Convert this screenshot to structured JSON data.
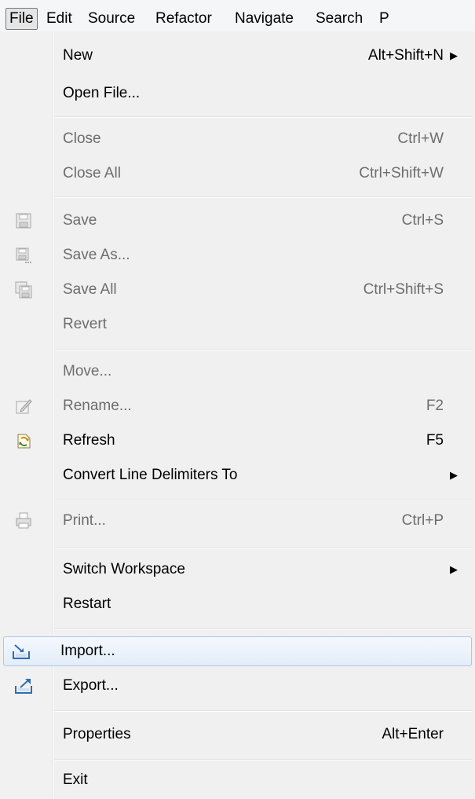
{
  "menubar": {
    "file": "File",
    "edit": "Edit",
    "source": "Source",
    "refactor": "Refactor",
    "navigate": "Navigate",
    "search": "Search",
    "project": "P"
  },
  "menu": {
    "new": {
      "label": "New",
      "accel": "Alt+Shift+N"
    },
    "open_file": {
      "label": "Open File..."
    },
    "close": {
      "label": "Close",
      "accel": "Ctrl+W"
    },
    "close_all": {
      "label": "Close All",
      "accel": "Ctrl+Shift+W"
    },
    "save": {
      "label": "Save",
      "accel": "Ctrl+S"
    },
    "save_as": {
      "label": "Save As..."
    },
    "save_all": {
      "label": "Save All",
      "accel": "Ctrl+Shift+S"
    },
    "revert": {
      "label": "Revert"
    },
    "move": {
      "label": "Move..."
    },
    "rename": {
      "label": "Rename...",
      "accel": "F2"
    },
    "refresh": {
      "label": "Refresh",
      "accel": "F5"
    },
    "convert": {
      "label": "Convert Line Delimiters To"
    },
    "print": {
      "label": "Print...",
      "accel": "Ctrl+P"
    },
    "switch_workspace": {
      "label": "Switch Workspace"
    },
    "restart": {
      "label": "Restart"
    },
    "import": {
      "label": "Import..."
    },
    "export": {
      "label": "Export..."
    },
    "properties": {
      "label": "Properties",
      "accel": "Alt+Enter"
    },
    "exit": {
      "label": "Exit"
    }
  },
  "icons": {
    "save": "save-icon",
    "save_as": "save-as-icon",
    "save_all": "save-all-icon",
    "rename": "rename-icon",
    "refresh": "refresh-icon",
    "print": "print-icon",
    "import": "import-icon",
    "export": "export-icon",
    "submenu": "chevron-right-icon"
  },
  "colors": {
    "disabled_text": "#6d6d6d",
    "hover_border": "#a8c8ec",
    "icon_blue": "#2f6db5"
  }
}
